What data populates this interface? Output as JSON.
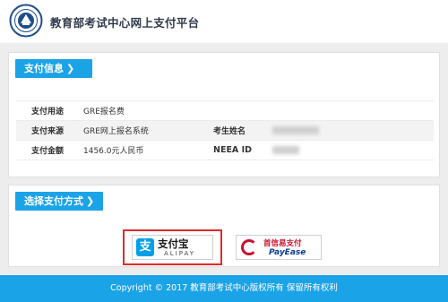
{
  "header": {
    "title": "教育部考试中心网上支付平台",
    "logo_icon": "neea-seal-icon"
  },
  "payment_info": {
    "section_label": "支付信息",
    "rows": [
      {
        "label": "支付用途",
        "value": "GRE报名费",
        "label2": "",
        "value2": ""
      },
      {
        "label": "支付来源",
        "value": "GRE网上报名系统",
        "label2": "考生姓名",
        "value2": ""
      },
      {
        "label": "支付金额",
        "value": "1456.0元人民币",
        "label2": "NEEA ID",
        "value2": ""
      }
    ]
  },
  "payment_method": {
    "section_label": "选择支付方式",
    "options": [
      {
        "name": "alipay",
        "text_cn": "支付宝",
        "text_en": "ALIPAY",
        "selected": true
      },
      {
        "name": "payease",
        "text_cn": "首信易支付",
        "text_en": "PayEase",
        "selected": false
      }
    ]
  },
  "footer": {
    "text": "Copyright © 2017 教育部考试中心版权所有 保留所有权利"
  },
  "colors": {
    "accent": "#1ba3e8",
    "selected_border": "#e12a2a",
    "payease_red": "#c8102e",
    "payease_blue": "#0b3d91"
  }
}
